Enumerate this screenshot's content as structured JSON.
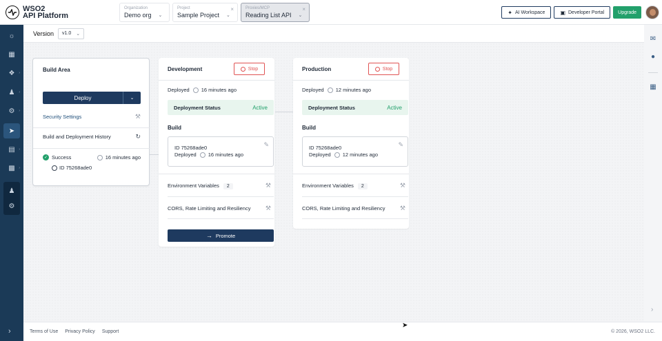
{
  "brand": {
    "line1": "WSO2",
    "line2": "API Platform"
  },
  "selectors": {
    "org": {
      "caption": "Organization",
      "value": "Demo org"
    },
    "project": {
      "caption": "Project",
      "value": "Sample Project",
      "clear": "×"
    },
    "proxy": {
      "caption": "Proxies/MCP",
      "value": "Reading List API",
      "clear": "×"
    }
  },
  "top_actions": {
    "ai_workspace": "AI Workspace",
    "developer_portal": "Developer Portal",
    "upgrade": "Upgrade"
  },
  "version": {
    "label": "Version",
    "value": "v1.0"
  },
  "build_area": {
    "title": "Build Area",
    "deploy_label": "Deploy",
    "security_settings": "Security Settings",
    "history": "Build and Deployment History",
    "last_build": {
      "status": "Success",
      "time": "16 minutes ago",
      "id": "ID 75268ade0"
    }
  },
  "environments": [
    {
      "title": "Development",
      "stop_label": "Stop",
      "deployed_label": "Deployed",
      "deployed_time": "16 minutes ago",
      "status_key": "Deployment Status",
      "status_value": "Active",
      "build_label": "Build",
      "build_id": "ID 75268ade0",
      "build_deployed_label": "Deployed",
      "build_time": "16 minutes ago",
      "env_vars_label": "Environment Variables",
      "env_vars_count": "2",
      "cors_label": "CORS, Rate Limiting and Resiliency",
      "promote_label": "Promote"
    },
    {
      "title": "Production",
      "stop_label": "Stop",
      "deployed_label": "Deployed",
      "deployed_time": "12 minutes ago",
      "status_key": "Deployment Status",
      "status_value": "Active",
      "build_label": "Build",
      "build_id": "ID 75268ade0",
      "build_deployed_label": "Deployed",
      "build_time": "12 minutes ago",
      "env_vars_label": "Environment Variables",
      "env_vars_count": "2",
      "cors_label": "CORS, Rate Limiting and Resiliency"
    }
  ],
  "footer": {
    "links": [
      "Terms of Use",
      "Privacy Policy",
      "Support"
    ],
    "copyright": "© 2026, WSO2 LLC."
  },
  "colors": {
    "sidebar": "#1b3a57",
    "primary": "#1e3a5f",
    "success": "#22a06b",
    "danger": "#e05252"
  },
  "icons": {
    "sidebar": [
      "bulb-icon",
      "grid-icon",
      "tags-icon",
      "users-icon",
      "settings-icon",
      "rocket-icon",
      "bar-chart-icon",
      "apps-icon",
      "user-settings-icon",
      "gear-icon"
    ],
    "right_rail": [
      "chat-bot-icon",
      "discord-icon",
      "calendar-icon"
    ]
  }
}
